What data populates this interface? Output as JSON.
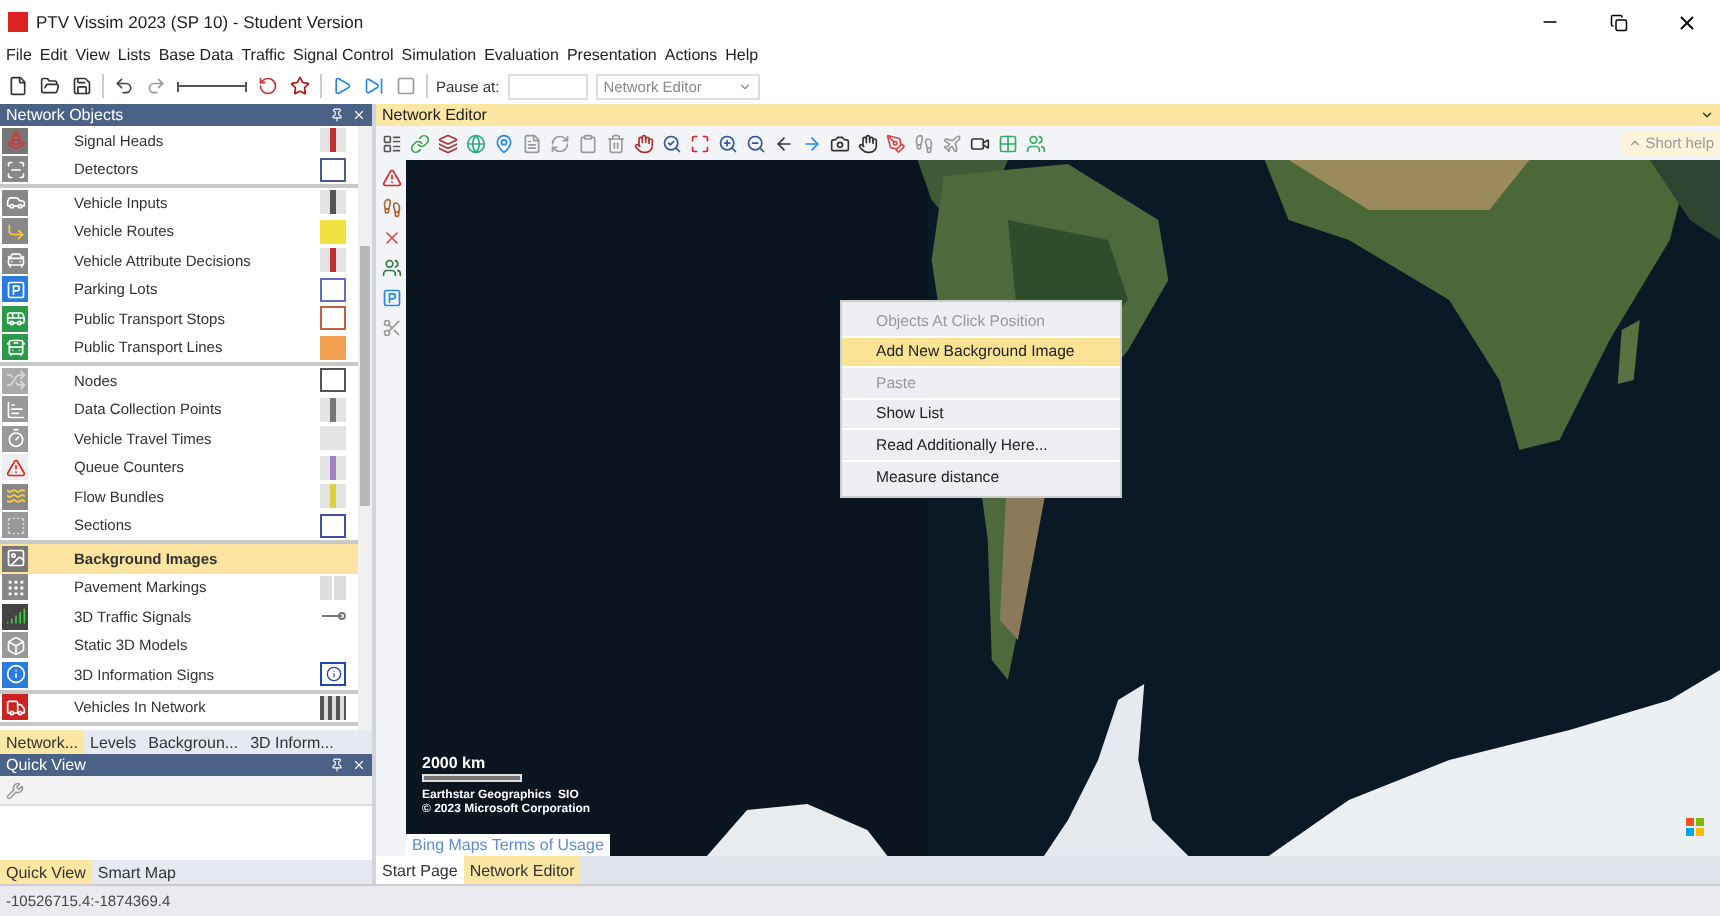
{
  "window": {
    "title": "PTV Vissim 2023 (SP 10) - Student Version"
  },
  "menu": [
    "File",
    "Edit",
    "View",
    "Lists",
    "Base Data",
    "Traffic",
    "Signal Control",
    "Simulation",
    "Evaluation",
    "Presentation",
    "Actions",
    "Help"
  ],
  "toolbar": {
    "pause_label": "Pause at:",
    "view_select": "Network Editor"
  },
  "network_objects": {
    "title": "Network Objects",
    "groups": [
      {
        "items": [
          {
            "label": "Signal Heads",
            "selected": false,
            "swatch": {
              "kind": "line",
              "color": "#c0302f"
            }
          },
          {
            "label": "Detectors",
            "selected": false,
            "swatch": {
              "kind": "box",
              "color": "#4a5a8a"
            }
          }
        ]
      },
      {
        "items": [
          {
            "label": "Vehicle Inputs",
            "selected": false,
            "swatch": {
              "kind": "line",
              "color": "#555555"
            }
          },
          {
            "label": "Vehicle Routes",
            "selected": false,
            "swatch": {
              "kind": "fill",
              "color": "#f0e040"
            }
          },
          {
            "label": "Vehicle Attribute Decisions",
            "selected": false,
            "swatch": {
              "kind": "line",
              "color": "#c0302f"
            }
          },
          {
            "label": "Parking Lots",
            "selected": false,
            "swatch": {
              "kind": "box",
              "color": "#6070c0"
            }
          },
          {
            "label": "Public Transport Stops",
            "selected": false,
            "swatch": {
              "kind": "box",
              "color": "#c06040"
            }
          },
          {
            "label": "Public Transport Lines",
            "selected": false,
            "swatch": {
              "kind": "fill",
              "color": "#f0a050"
            }
          }
        ]
      },
      {
        "items": [
          {
            "label": "Nodes",
            "selected": false,
            "swatch": {
              "kind": "box",
              "color": "#555555"
            }
          },
          {
            "label": "Data Collection Points",
            "selected": false,
            "swatch": {
              "kind": "line",
              "color": "#777777"
            }
          },
          {
            "label": "Vehicle Travel Times",
            "selected": false,
            "swatch": {
              "kind": "blank"
            }
          },
          {
            "label": "Queue Counters",
            "selected": false,
            "swatch": {
              "kind": "line",
              "color": "#a080c0"
            }
          },
          {
            "label": "Flow Bundles",
            "selected": false,
            "swatch": {
              "kind": "line",
              "color": "#e0d040"
            }
          },
          {
            "label": "Sections",
            "selected": false,
            "swatch": {
              "kind": "box",
              "color": "#4050a0"
            }
          }
        ]
      },
      {
        "items": [
          {
            "label": "Background Images",
            "selected": true,
            "swatch": {
              "kind": "none"
            }
          },
          {
            "label": "Pavement Markings",
            "selected": false,
            "swatch": {
              "kind": "split"
            }
          },
          {
            "label": "3D Traffic Signals",
            "selected": false,
            "swatch": {
              "kind": "dumbbell"
            }
          },
          {
            "label": "Static 3D Models",
            "selected": false,
            "swatch": {
              "kind": "none"
            }
          },
          {
            "label": "3D Information Signs",
            "selected": false,
            "swatch": {
              "kind": "info"
            }
          }
        ]
      },
      {
        "items": [
          {
            "label": "Vehicles In Network",
            "selected": false,
            "swatch": {
              "kind": "bars"
            }
          }
        ]
      }
    ],
    "tabs": [
      {
        "label": "Network...",
        "selected": true
      },
      {
        "label": "Levels",
        "selected": false
      },
      {
        "label": "Backgroun...",
        "selected": false
      },
      {
        "label": "3D Inform...",
        "selected": false
      }
    ]
  },
  "quick_view": {
    "title": "Quick View",
    "tabs": [
      {
        "label": "Quick View",
        "selected": true
      },
      {
        "label": "Smart Map",
        "selected": false
      }
    ]
  },
  "editor": {
    "title": "Network Editor",
    "short_help": "Short help",
    "map": {
      "scale": "2000 km",
      "attribution": [
        "Earthstar Geographics  SIO",
        "© 2023 Microsoft Corporation"
      ],
      "terms_link": "Bing Maps Terms of Usage"
    },
    "context_menu": [
      {
        "label": "Objects At Click Position",
        "disabled": true,
        "selected": false
      },
      {
        "label": "Add New Background Image",
        "disabled": false,
        "selected": true
      },
      {
        "label": "Paste",
        "disabled": true,
        "selected": false
      },
      {
        "label": "Show List",
        "disabled": false,
        "selected": false
      },
      {
        "label": "Read Additionally Here...",
        "disabled": false,
        "selected": false
      },
      {
        "label": "Measure distance",
        "disabled": false,
        "selected": false
      }
    ],
    "tabs": [
      {
        "label": "Start Page",
        "selected": false
      },
      {
        "label": "Network Editor",
        "selected": true
      }
    ]
  },
  "status_bar": {
    "coordinates": "-10526715.4:-1874369.4"
  }
}
